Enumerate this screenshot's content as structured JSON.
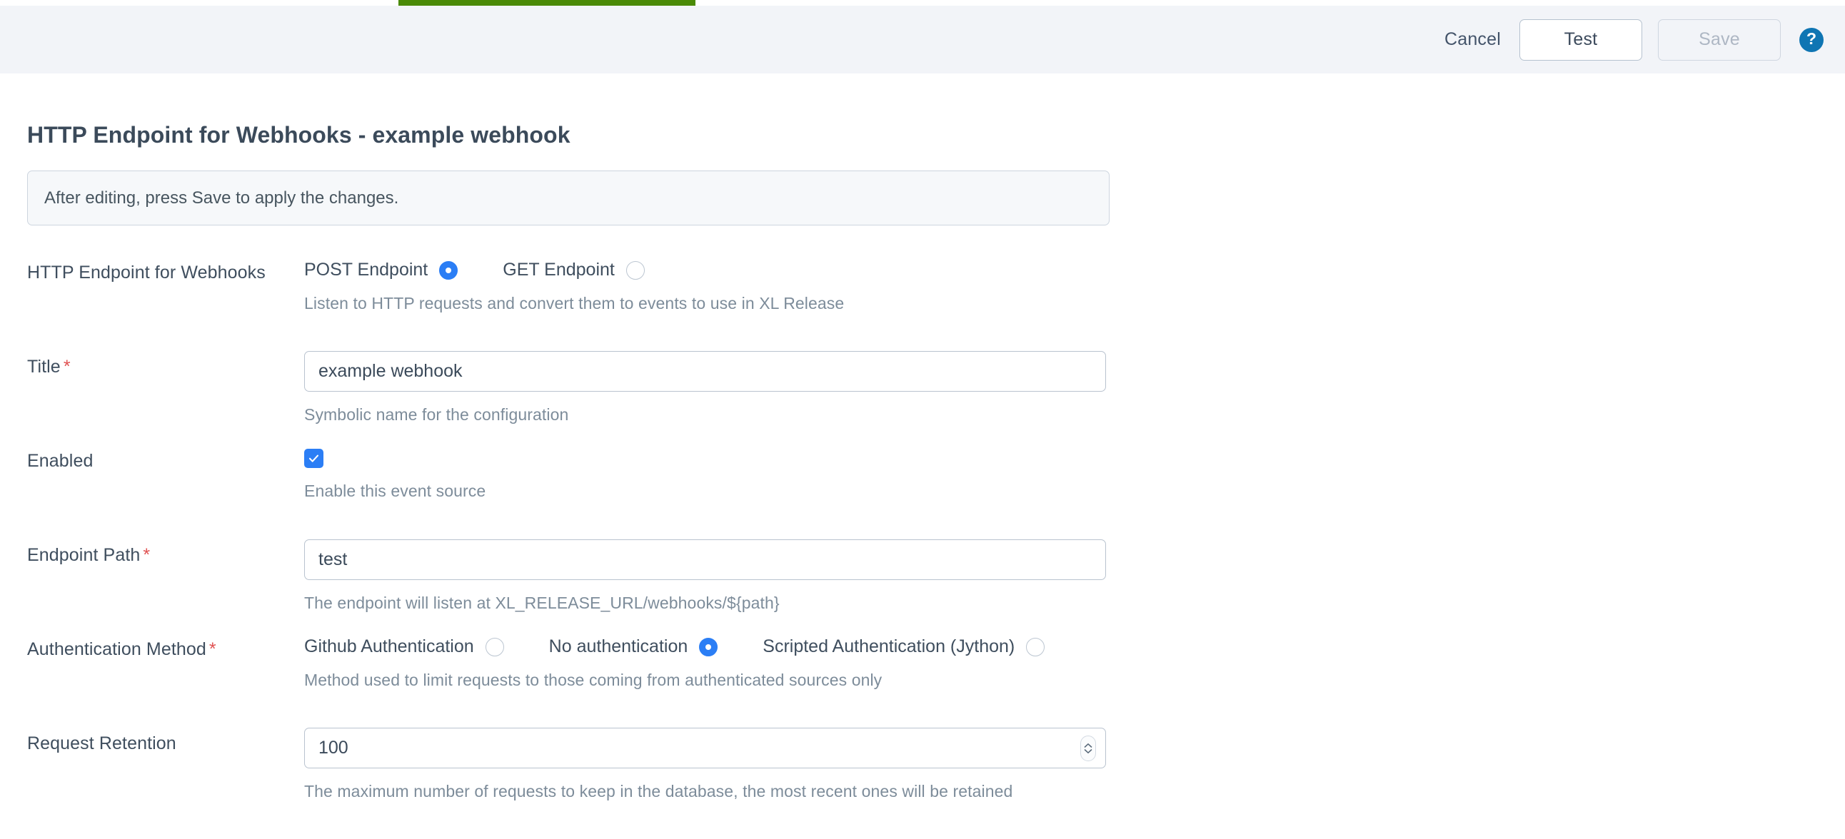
{
  "header": {
    "cancel_label": "Cancel",
    "test_label": "Test",
    "save_label": "Save",
    "help_glyph": "?",
    "accent_green": "#4a8a06",
    "accent_blue": "#2b7ef5",
    "help_blue": "#0f75b3",
    "bar_bg": "#f2f4f8"
  },
  "page": {
    "title": "HTTP Endpoint for Webhooks - example webhook",
    "notice": "After editing, press Save to apply the changes."
  },
  "form": {
    "endpoint_type": {
      "label": "HTTP Endpoint for Webhooks",
      "required": false,
      "options": [
        {
          "label": "POST Endpoint",
          "selected": true
        },
        {
          "label": "GET Endpoint",
          "selected": false
        }
      ],
      "helper": "Listen to HTTP requests and convert them to events to use in XL Release"
    },
    "title": {
      "label": "Title",
      "required_mark": "*",
      "value": "example webhook",
      "placeholder": "",
      "helper": "Symbolic name for the configuration"
    },
    "enabled": {
      "label": "Enabled",
      "checked": true,
      "helper": "Enable this event source"
    },
    "endpoint_path": {
      "label": "Endpoint Path",
      "required_mark": "*",
      "value": "test",
      "placeholder": "",
      "helper": "The endpoint will listen at XL_RELEASE_URL/webhooks/${path}"
    },
    "auth_method": {
      "label": "Authentication Method",
      "required_mark": "*",
      "options": [
        {
          "label": "Github Authentication",
          "selected": false
        },
        {
          "label": "No authentication",
          "selected": true
        },
        {
          "label": "Scripted Authentication (Jython)",
          "selected": false
        }
      ],
      "helper": "Method used to limit requests to those coming from authenticated sources only"
    },
    "request_retention": {
      "label": "Request Retention",
      "value": "100",
      "placeholder": "",
      "helper": "The maximum number of requests to keep in the database, the most recent ones will be retained"
    }
  }
}
